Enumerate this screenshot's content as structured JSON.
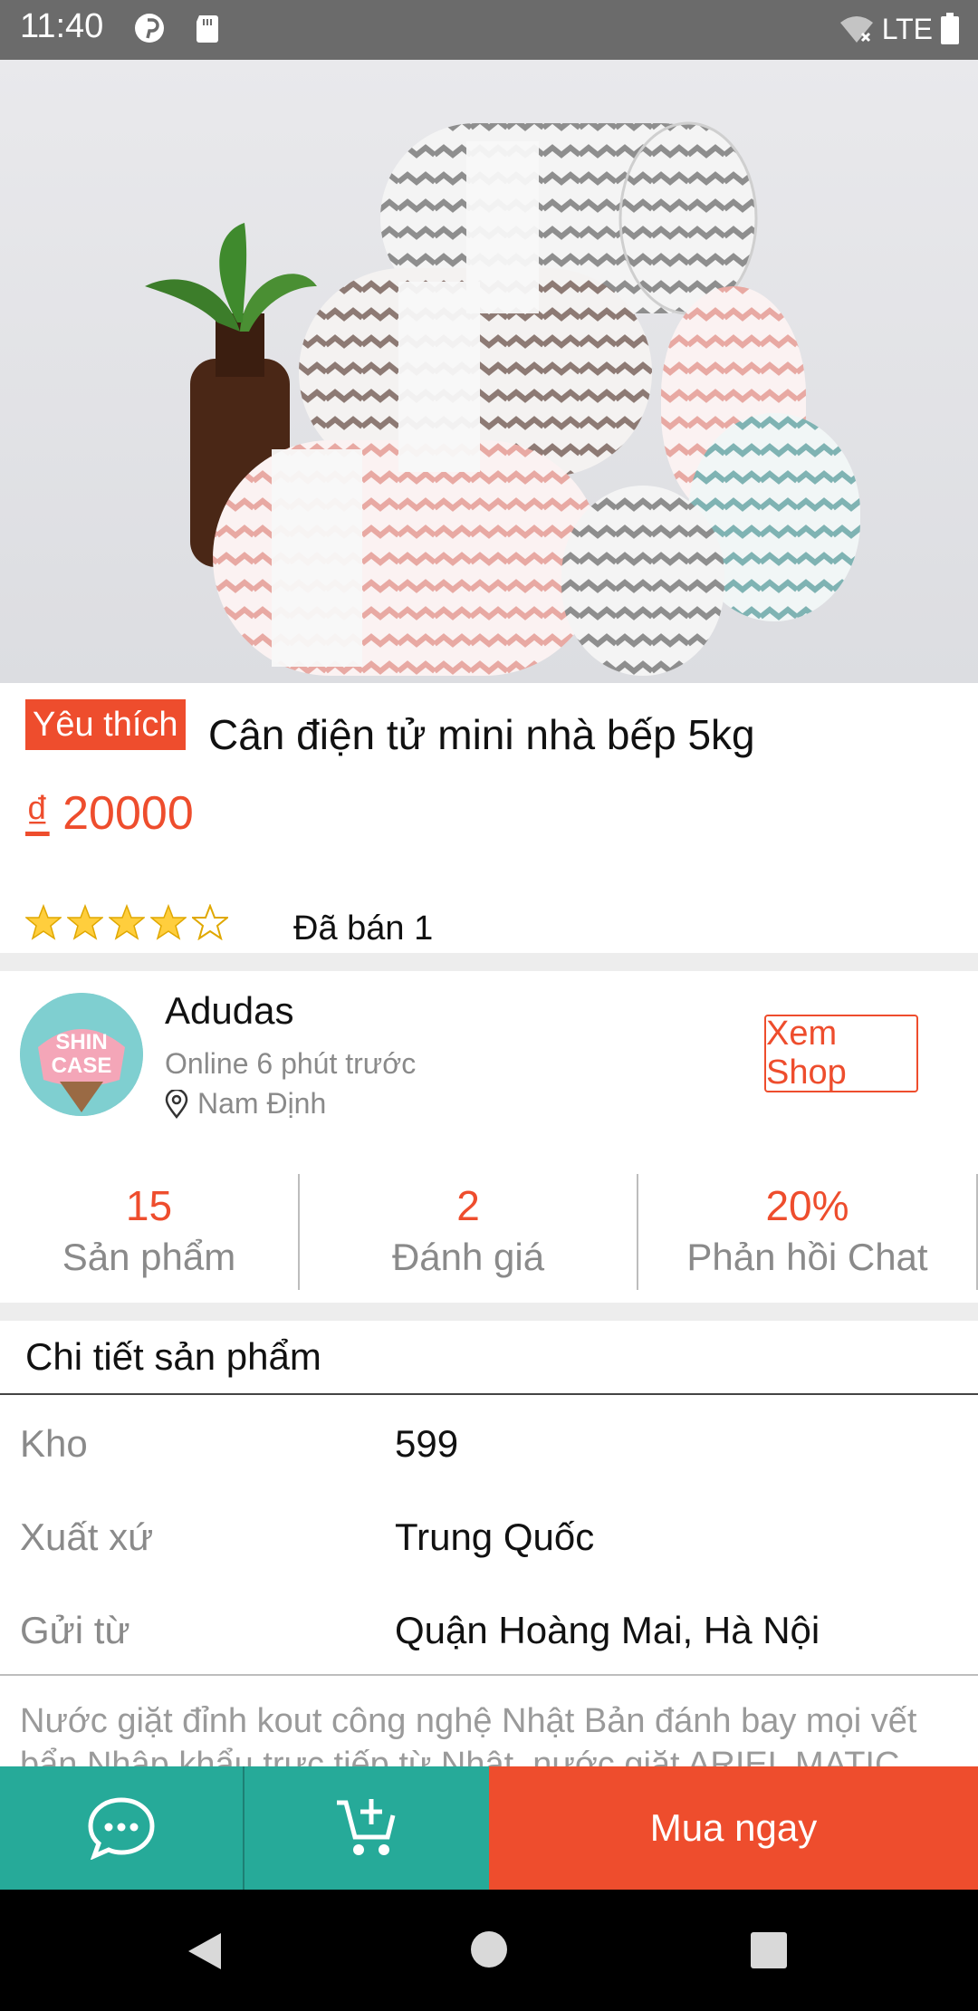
{
  "status_bar": {
    "time": "11:40",
    "network": "LTE"
  },
  "product": {
    "badge": "Yêu thích",
    "title": "Cân điện tử mini nhà bếp 5kg",
    "currency": "₫",
    "price": "20000",
    "rating": 4,
    "rating_max": 5,
    "sold": "Đã bán 1"
  },
  "shop": {
    "avatar_text_top": "SHIN",
    "avatar_text_bottom": "CASE",
    "name": "Adudas",
    "online": "Online 6 phút trước",
    "location": "Nam Định",
    "view_shop_label": "Xem Shop",
    "stats": [
      {
        "value": "15",
        "label": "Sản phẩm"
      },
      {
        "value": "2",
        "label": "Đánh giá"
      },
      {
        "value": "20%",
        "label": "Phản hồi Chat"
      }
    ]
  },
  "details": {
    "title": "Chi tiết sản phẩm",
    "rows": [
      {
        "label": "Kho",
        "value": "599"
      },
      {
        "label": "Xuất xứ",
        "value": "Trung Quốc"
      },
      {
        "label": "Gửi từ",
        "value": "Quận Hoàng Mai, Hà Nội"
      }
    ],
    "description": "Nước giặt đỉnh kout công nghệ Nhật Bản đánh bay mọi vết bẩn Nhập khẩu trực tiếp từ Nhật, nước giặt ARIEL MATIC"
  },
  "actions": {
    "buy_label": "Mua ngay"
  },
  "colors": {
    "accent": "#ee4d2d",
    "teal": "#26aa99",
    "star": "#ffce3d"
  }
}
